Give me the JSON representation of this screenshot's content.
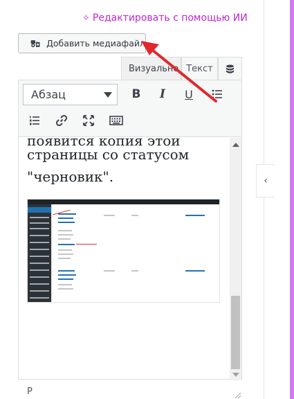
{
  "ai_link": {
    "label": "Редактировать с помощью ИИ",
    "icon": "sparkle-icon",
    "color": "#c026d3"
  },
  "media_button": {
    "label": "Добавить медиафайл",
    "icon": "media-icon"
  },
  "tabs": [
    {
      "label": "Визуально",
      "active": true
    },
    {
      "label": "Текст",
      "active": false
    },
    {
      "label": "",
      "icon": "database-icon"
    }
  ],
  "toolbar": {
    "format_select": "Абзац",
    "buttons": [
      {
        "name": "bold",
        "glyph": "B"
      },
      {
        "name": "italic",
        "glyph": "I"
      },
      {
        "name": "underline",
        "glyph": "U"
      },
      {
        "name": "bullet-list",
        "glyph": ""
      },
      {
        "name": "numbered-list",
        "glyph": ""
      },
      {
        "name": "link",
        "glyph": ""
      },
      {
        "name": "fullscreen",
        "glyph": ""
      },
      {
        "name": "toolbar-toggle",
        "glyph": ""
      }
    ]
  },
  "content": {
    "line_cut": "появится копия этой",
    "line_2": "страницы со статусом",
    "line_3": "\"черновик\"."
  },
  "path_label": "P",
  "collapse_button": "‹",
  "accent_purple": "#cf7bef",
  "annotation_arrow_color": "#e0282e"
}
